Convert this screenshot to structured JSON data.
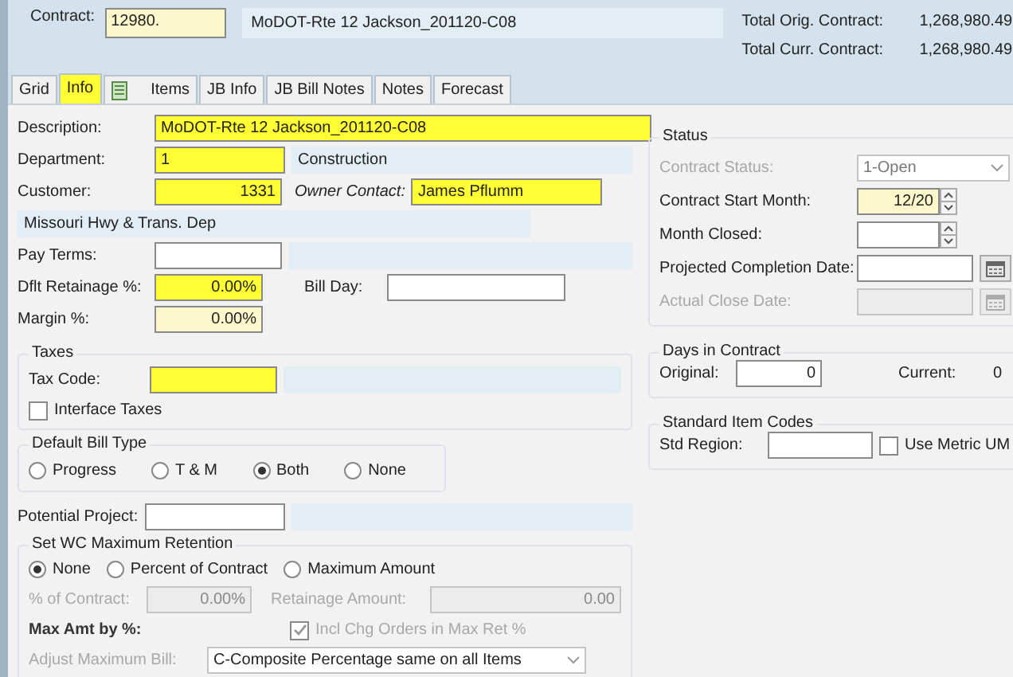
{
  "header": {
    "contract_label": "Contract:",
    "contract_number": {
      "value": "12980.",
      "readonly": true
    },
    "contract_name": "MoDOT-Rte 12 Jackson_201120-C08",
    "totals": [
      {
        "label": "Total Orig. Contract:",
        "value": "1,268,980.49"
      },
      {
        "label": "Total Curr. Contract:",
        "value": "1,268,980.49"
      }
    ]
  },
  "tabs": [
    {
      "label": "Grid",
      "selected": false,
      "highlighted": false,
      "kind": "plain"
    },
    {
      "label": "Info",
      "selected": true,
      "highlighted": true,
      "kind": "plain"
    },
    {
      "label": "Items",
      "selected": false,
      "highlighted": false,
      "kind": "icon"
    },
    {
      "label": "JB Info",
      "selected": false,
      "highlighted": false,
      "kind": "plain"
    },
    {
      "label": "JB Bill Notes",
      "selected": false,
      "highlighted": false,
      "kind": "plain"
    },
    {
      "label": "Notes",
      "selected": false,
      "highlighted": false,
      "kind": "plain"
    },
    {
      "label": "Forecast",
      "selected": false,
      "highlighted": false,
      "kind": "plain"
    }
  ],
  "description": {
    "label": "Description:",
    "value": "MoDOT-Rte 12 Jackson_201120-C08",
    "highlighted": true
  },
  "department": {
    "label": "Department:",
    "value": "1",
    "highlighted": true,
    "name": "Construction"
  },
  "customer": {
    "label": "Customer:",
    "value": "1331",
    "highlighted": true
  },
  "owner_contact": {
    "label": "Owner Contact:",
    "value": "James Pflumm",
    "highlighted": true
  },
  "customer_name": "Missouri Hwy & Trans. Dep",
  "pay_terms": {
    "label": "Pay Terms:"
  },
  "dflt_retainage": {
    "label": "Dflt Retainage %:",
    "value": "0.00%",
    "highlighted": true
  },
  "bill_day": {
    "label": "Bill Day:"
  },
  "margin": {
    "label": "Margin %:",
    "value": "0.00%",
    "readonly": true
  },
  "taxes": {
    "title": "Taxes",
    "tax_code": {
      "label": "Tax Code:",
      "highlighted": true
    },
    "interface_taxes": {
      "label": "Interface Taxes",
      "checked": false
    }
  },
  "default_bill_type": {
    "title": "Default Bill Type",
    "options": [
      {
        "label": "Progress",
        "selected": false
      },
      {
        "label": "T & M",
        "selected": false
      },
      {
        "label": "Both",
        "selected": true
      },
      {
        "label": "None",
        "selected": false
      }
    ]
  },
  "potential_project": {
    "label": "Potential Project:"
  },
  "wc_retention": {
    "title": "Set WC Maximum Retention",
    "options": [
      {
        "label": "None",
        "selected": true
      },
      {
        "label": "Percent of Contract",
        "selected": false
      },
      {
        "label": "Maximum Amount",
        "selected": false
      }
    ],
    "percent_of_contract": {
      "label": "% of Contract:",
      "value": "0.00%"
    },
    "retainage_amount": {
      "label": "Retainage Amount:",
      "value": "0.00"
    },
    "max_amt_label": "Max Amt by %:",
    "incl_chg_orders": {
      "label": "Incl Chg Orders in Max Ret %",
      "checked": true
    },
    "adjust_max_bill": {
      "label": "Adjust Maximum Bill:",
      "value": "C-Composite Percentage same on all Items"
    }
  },
  "status": {
    "title": "Status",
    "contract_status": {
      "label": "Contract Status:",
      "value": "1-Open",
      "disabled": true
    },
    "start_month": {
      "label": "Contract Start Month:",
      "value": "12/20",
      "readonly": true
    },
    "month_closed": {
      "label": "Month Closed:"
    },
    "projected_completion": {
      "label": "Projected Completion Date:",
      "disabled": false
    },
    "actual_close": {
      "label": "Actual Close Date:",
      "disabled": true
    }
  },
  "days_in_contract": {
    "title": "Days in Contract",
    "original": {
      "label": "Original:",
      "value": "0"
    },
    "current": {
      "label": "Current:",
      "value": "0"
    }
  },
  "standard_item_codes": {
    "title": "Standard Item Codes",
    "std_region": {
      "label": "Std Region:"
    },
    "use_metric_um": {
      "label": "Use Metric UM",
      "checked": false
    }
  }
}
